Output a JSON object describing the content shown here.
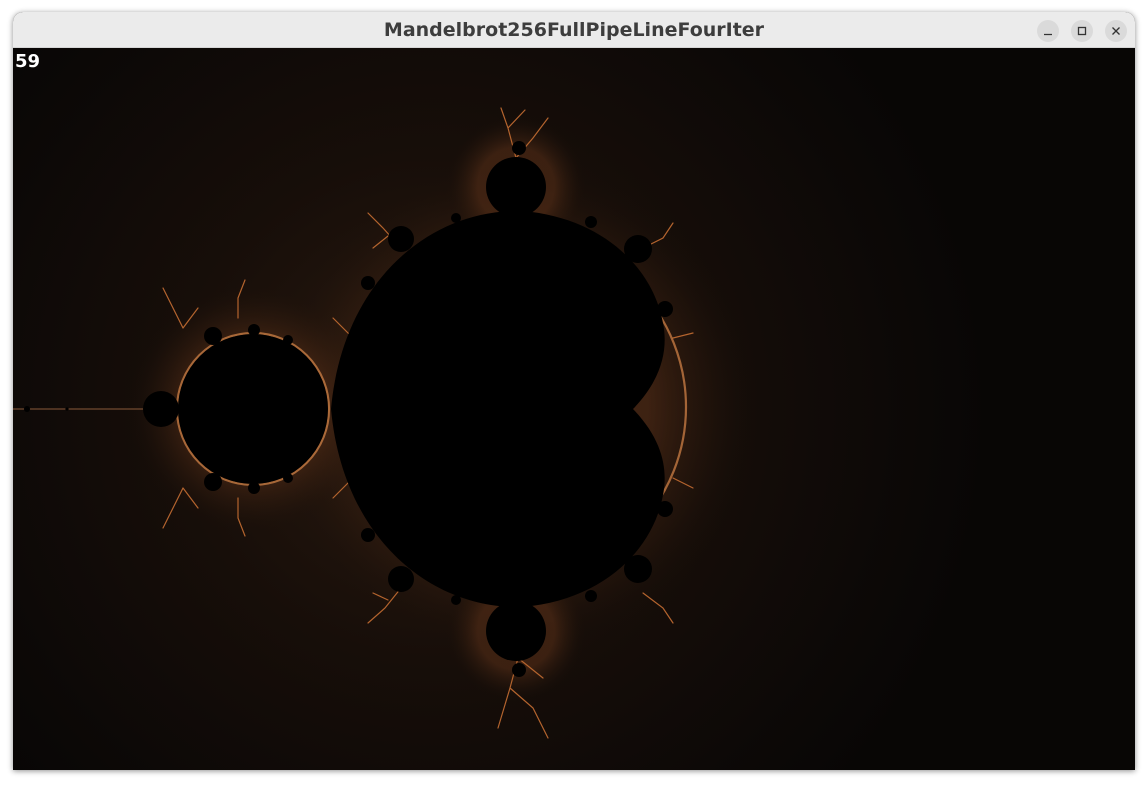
{
  "window": {
    "title": "Mandelbrot256FullPipeLineFourIter",
    "controls": {
      "minimize_icon": "minimize-icon",
      "maximize_icon": "maximize-icon",
      "close_icon": "close-icon"
    }
  },
  "overlay": {
    "fps_counter": "59"
  },
  "colors": {
    "background": "#0a0706",
    "set_fill": "#000000",
    "fringe_orange": "#c4723a",
    "fringe_copper": "#8a4a26",
    "titlebar": "#ebebeb",
    "title_text": "#3d3d3d"
  }
}
